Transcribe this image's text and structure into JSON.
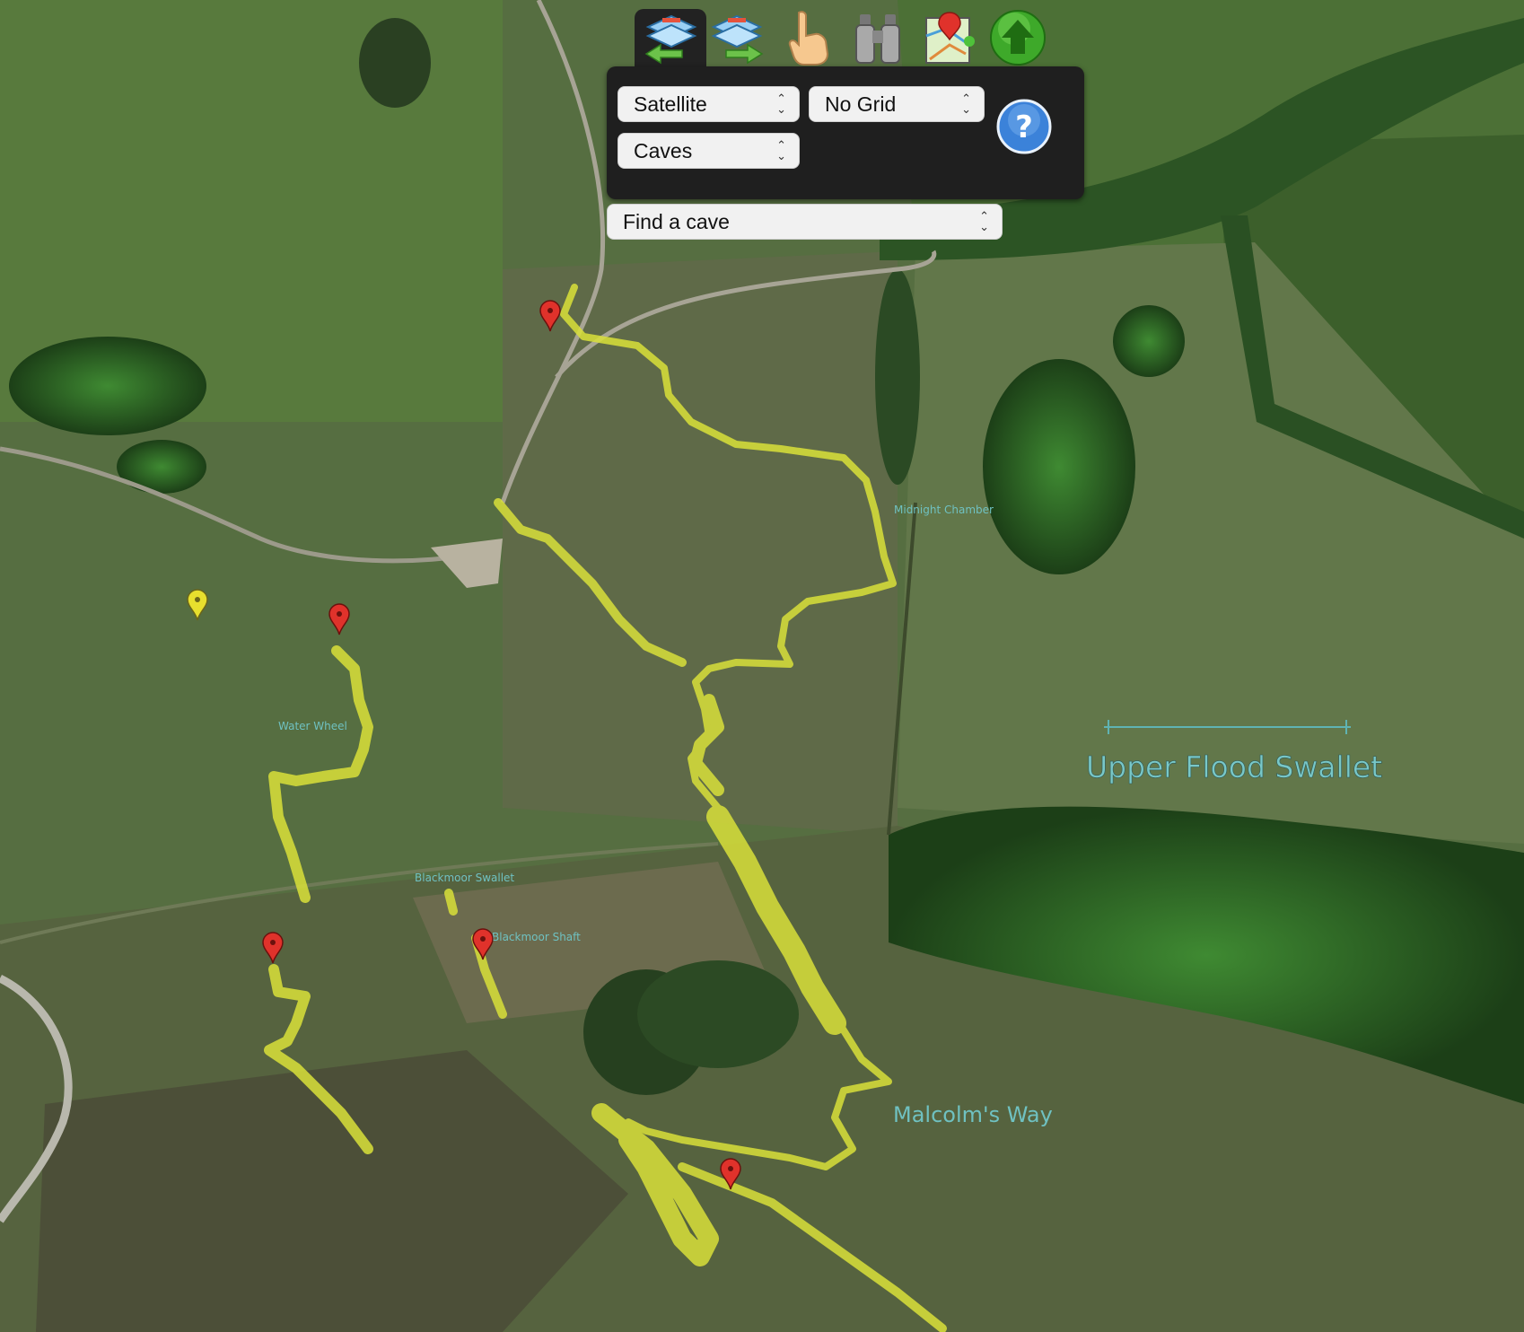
{
  "toolbar": {
    "icons": [
      "layers-up-icon",
      "layers-down-icon",
      "pointing-hand-icon",
      "binoculars-icon",
      "map-pin-icon",
      "green-up-arrow-icon"
    ]
  },
  "controls": {
    "map_type": "Satellite",
    "grid": "No Grid",
    "overlay": "Caves",
    "find": "Find a cave"
  },
  "map": {
    "title": "Upper Flood Swallet",
    "passage_labels": {
      "malcolms_way": "Malcolm's Way",
      "water_wheel": "Water Wheel",
      "blackmoor_swallet": "Blackmoor Swallet",
      "blackmoor_shaft": "Blackmoor Shaft",
      "midnight_chamber": "Midnight Chamber"
    },
    "pin_colors": {
      "red": "#e0322b",
      "yellow": "#e7df2e"
    },
    "overlay_color": "#d9e03a"
  }
}
